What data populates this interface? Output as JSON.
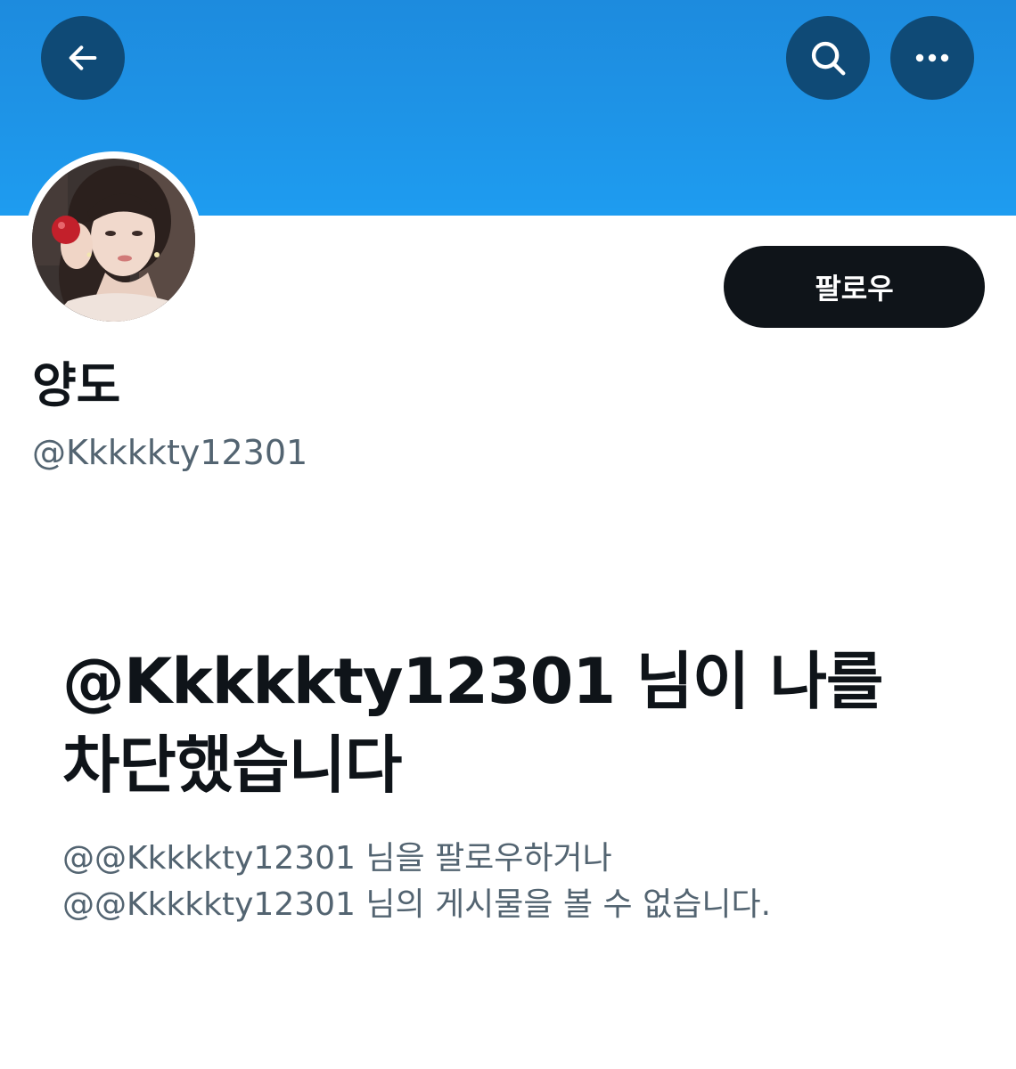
{
  "header": {
    "back_icon": "arrow-left-icon",
    "search_icon": "search-icon",
    "more_icon": "more-horizontal-icon",
    "banner_color": "#1E93E6",
    "button_color": "#0F4A76"
  },
  "profile": {
    "display_name": "양도",
    "handle": "@Kkkkkty12301",
    "follow_label": "팔로우"
  },
  "blocked": {
    "title_line1": "@Kkkkkty12301 님이 나를",
    "title_line2": "차단했습니다",
    "desc_line1": "@@Kkkkkty12301 님을 팔로우하거나",
    "desc_line2": "@@Kkkkkty12301 님의 게시물을 볼 수 없습니다."
  }
}
